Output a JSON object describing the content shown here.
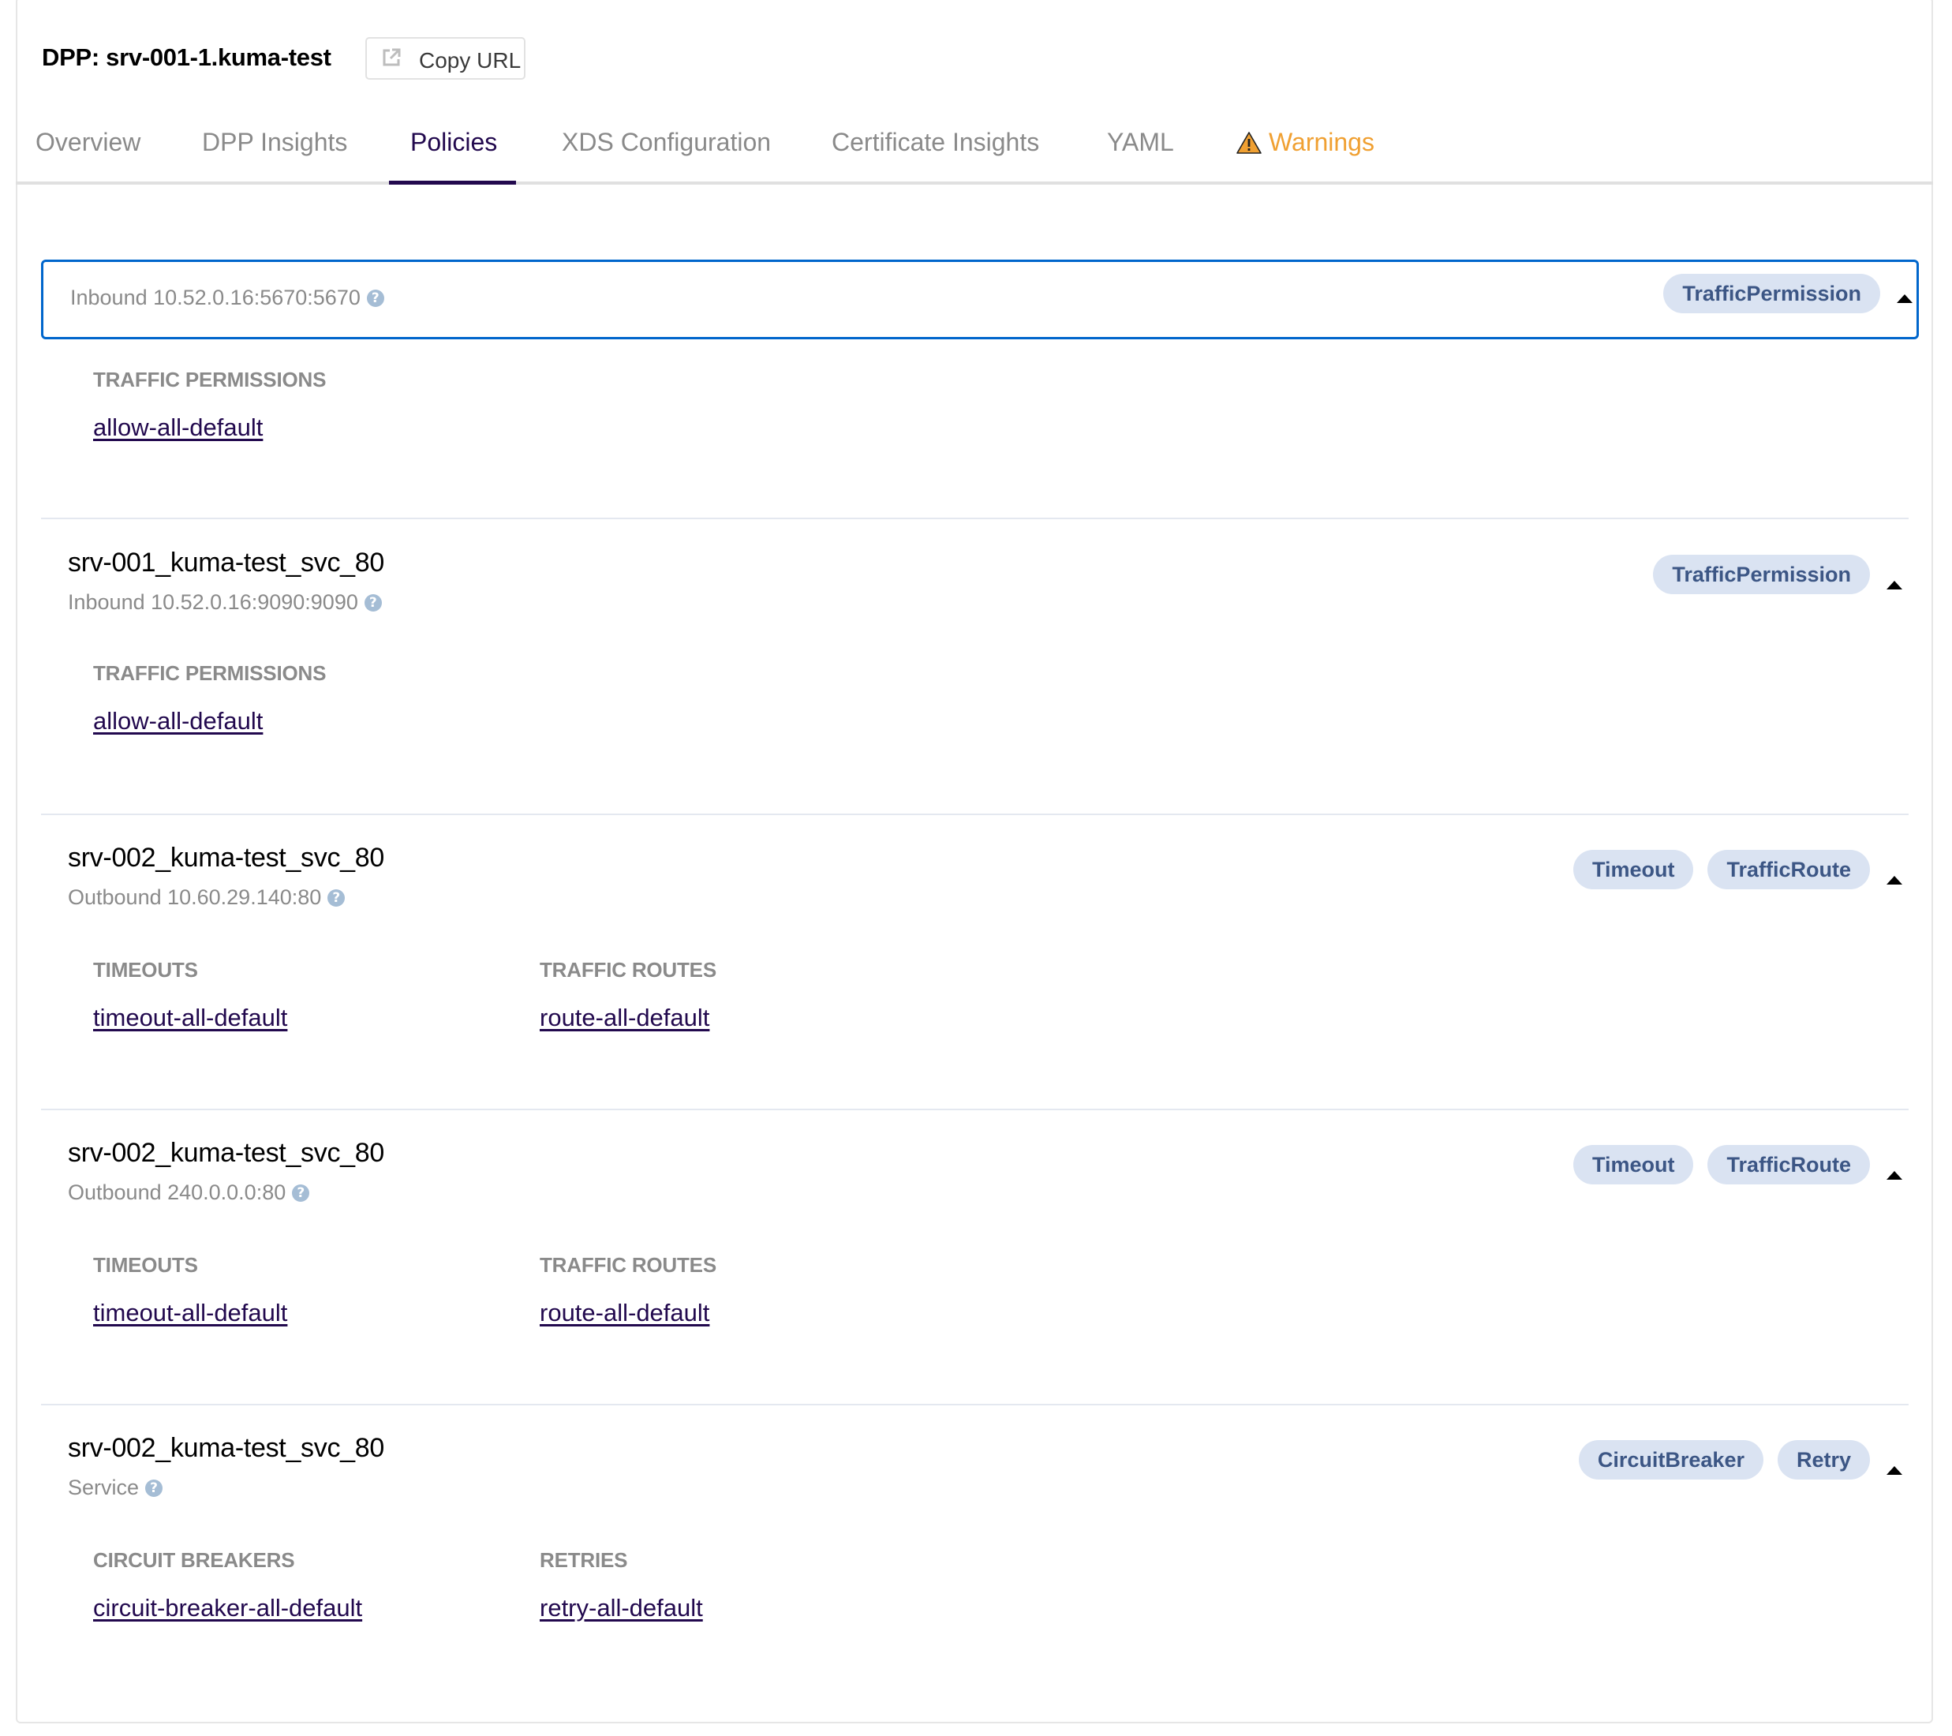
{
  "header": {
    "title": "DPP: srv-001-1.kuma-test",
    "copy_url_label": "Copy URL",
    "copy_url_icon": "external-link-icon"
  },
  "tabs": [
    {
      "label": "Overview",
      "active": false
    },
    {
      "label": "DPP Insights",
      "active": false
    },
    {
      "label": "Policies",
      "active": true
    },
    {
      "label": "XDS Configuration",
      "active": false
    },
    {
      "label": "Certificate Insights",
      "active": false
    },
    {
      "label": "YAML",
      "active": false
    },
    {
      "label": "Warnings",
      "active": false,
      "icon": "warning-triangle-icon"
    }
  ],
  "colors": {
    "active_tab": "#22094e",
    "warning": "#f0a032",
    "focus_border": "#0066cc",
    "badge_bg": "#dae3f2",
    "badge_text": "#3c5685",
    "link": "#22094e"
  },
  "sections": [
    {
      "name": "",
      "subtitle": "Inbound 10.52.0.16:5670:5670",
      "badges": [
        "TrafficPermission"
      ],
      "expanded": true,
      "groups": [
        {
          "label": "TRAFFIC PERMISSIONS",
          "links": [
            "allow-all-default"
          ]
        }
      ]
    },
    {
      "name": "srv-001_kuma-test_svc_80",
      "subtitle": "Inbound 10.52.0.16:9090:9090",
      "badges": [
        "TrafficPermission"
      ],
      "expanded": true,
      "groups": [
        {
          "label": "TRAFFIC PERMISSIONS",
          "links": [
            "allow-all-default"
          ]
        }
      ]
    },
    {
      "name": "srv-002_kuma-test_svc_80",
      "subtitle": "Outbound 10.60.29.140:80",
      "badges": [
        "Timeout",
        "TrafficRoute"
      ],
      "expanded": true,
      "groups": [
        {
          "label": "TIMEOUTS",
          "links": [
            "timeout-all-default"
          ]
        },
        {
          "label": "TRAFFIC ROUTES",
          "links": [
            "route-all-default"
          ]
        }
      ]
    },
    {
      "name": "srv-002_kuma-test_svc_80",
      "subtitle": "Outbound 240.0.0.0:80",
      "badges": [
        "Timeout",
        "TrafficRoute"
      ],
      "expanded": true,
      "groups": [
        {
          "label": "TIMEOUTS",
          "links": [
            "timeout-all-default"
          ]
        },
        {
          "label": "TRAFFIC ROUTES",
          "links": [
            "route-all-default"
          ]
        }
      ]
    },
    {
      "name": "srv-002_kuma-test_svc_80",
      "subtitle": "Service",
      "badges": [
        "CircuitBreaker",
        "Retry"
      ],
      "expanded": true,
      "groups": [
        {
          "label": "CIRCUIT BREAKERS",
          "links": [
            "circuit-breaker-all-default"
          ]
        },
        {
          "label": "RETRIES",
          "links": [
            "retry-all-default"
          ]
        }
      ]
    }
  ]
}
